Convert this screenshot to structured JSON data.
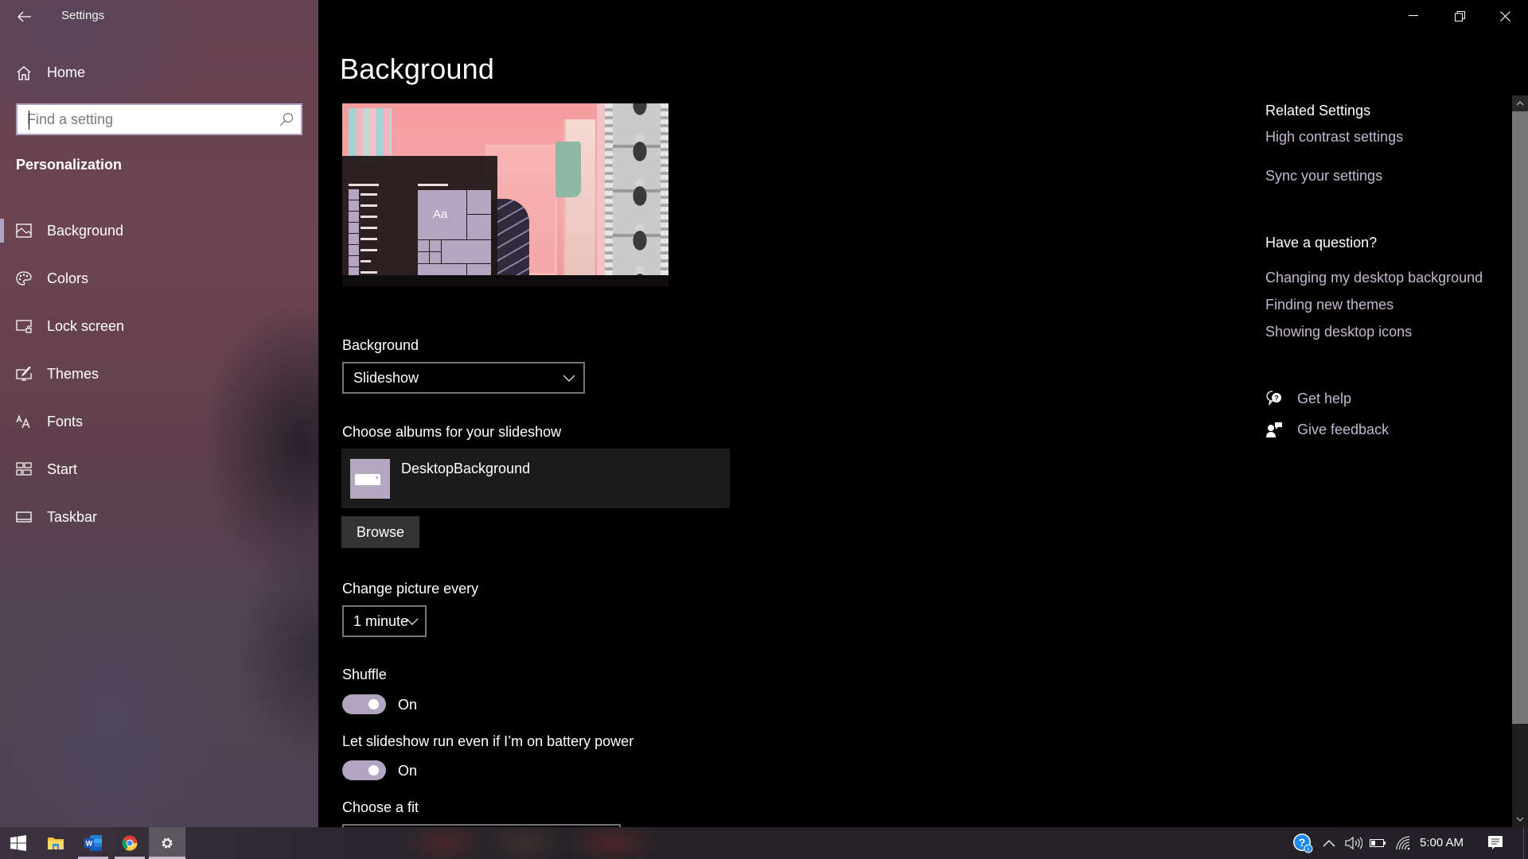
{
  "window": {
    "app_title": "Settings",
    "back_icon": "back-arrow-icon",
    "controls": {
      "minimize_icon": "minimize-icon",
      "restore_icon": "restore-icon",
      "close_icon": "close-icon"
    }
  },
  "sidebar": {
    "home_label": "Home",
    "search": {
      "placeholder": "Find a setting",
      "value": ""
    },
    "section_heading": "Personalization",
    "items": [
      {
        "label": "Background",
        "icon": "picture-icon",
        "selected": true
      },
      {
        "label": "Colors",
        "icon": "palette-icon",
        "selected": false
      },
      {
        "label": "Lock screen",
        "icon": "lock-screen-icon",
        "selected": false
      },
      {
        "label": "Themes",
        "icon": "themes-brush-icon",
        "selected": false
      },
      {
        "label": "Fonts",
        "icon": "fonts-icon",
        "selected": false
      },
      {
        "label": "Start",
        "icon": "start-tiles-icon",
        "selected": false
      },
      {
        "label": "Taskbar",
        "icon": "taskbar-icon",
        "selected": false
      }
    ],
    "accent_color": "#b3a5c1"
  },
  "main": {
    "page_title": "Background",
    "preview": {
      "sample_text": "Aa"
    },
    "background_field": {
      "label": "Background",
      "value": "Slideshow"
    },
    "albums": {
      "label": "Choose albums for your slideshow",
      "items": [
        {
          "name": "DesktopBackground",
          "icon": "drive-icon"
        }
      ],
      "browse_label": "Browse"
    },
    "interval_field": {
      "label": "Change picture every",
      "value": "1 minute"
    },
    "shuffle": {
      "label": "Shuffle",
      "state": "On",
      "on": true
    },
    "battery": {
      "label": "Let slideshow run even if I’m on battery power",
      "state": "On",
      "on": true
    },
    "fit_field": {
      "label": "Choose a fit"
    }
  },
  "aside": {
    "related_heading": "Related Settings",
    "related_links": [
      "High contrast settings",
      "Sync your settings"
    ],
    "question_heading": "Have a question?",
    "question_links": [
      "Changing my desktop background",
      "Finding new themes",
      "Showing desktop icons"
    ],
    "get_help": "Get help",
    "give_feedback": "Give feedback",
    "link_color": "#c4b6cf"
  },
  "taskbar": {
    "apps": [
      {
        "name": "start",
        "icon": "windows-start-icon"
      },
      {
        "name": "file-explorer",
        "icon": "folder-icon"
      },
      {
        "name": "word",
        "icon": "word-icon"
      },
      {
        "name": "chrome",
        "icon": "chrome-icon"
      },
      {
        "name": "settings",
        "icon": "gear-icon",
        "active": true
      }
    ],
    "tray": [
      "help-icon",
      "chevron-up-icon",
      "volume-icon",
      "battery-icon",
      "wifi-icon"
    ],
    "clock": "5:00 AM",
    "notifications_icon": "action-center-icon"
  }
}
